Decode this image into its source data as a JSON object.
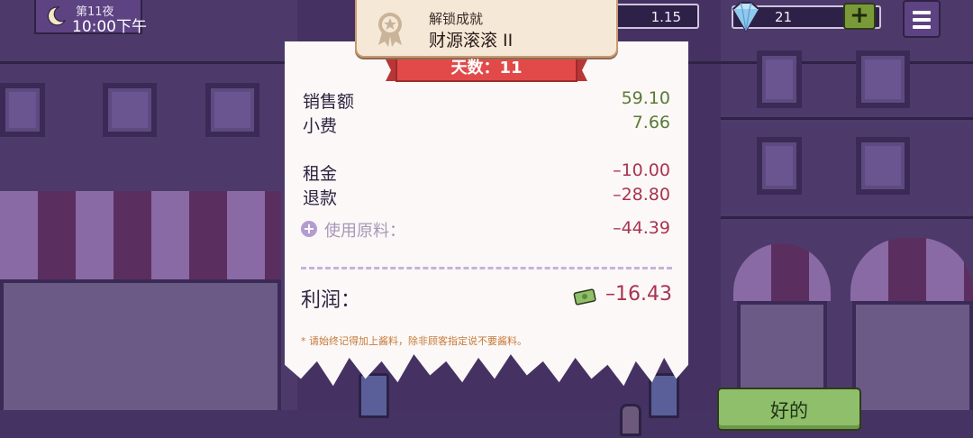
{
  "hud": {
    "night_label": "第11夜",
    "time": "10:00下午",
    "money": "1.15",
    "gems": "21",
    "plus_label": "+",
    "icons": [
      "moon-icon",
      "gem-icon",
      "menu-icon"
    ]
  },
  "achievement": {
    "title": "解锁成就",
    "name": "财源滚滚 II",
    "icon": "medal-icon"
  },
  "receipt": {
    "day_banner": "天数：11",
    "rows": [
      {
        "label": "销售额",
        "value": "59.10"
      },
      {
        "label": "小费",
        "value": "7.66"
      },
      {
        "label": "租金",
        "value": "–10.00"
      },
      {
        "label": "退款",
        "value": "–28.80"
      }
    ],
    "ingredients_label": "使用原料：",
    "ingredients_value": "–44.39",
    "profit_label": "利润：",
    "profit_value": "–16.43",
    "note": "* 请始终记得加上酱料，除非顾客指定说不要酱料。"
  },
  "ok_button": "好的",
  "colors": {
    "positive": "#5b7a36",
    "negative": "#a83450",
    "ribbon": "#e24a4a",
    "ok_button": "#8fbf6a",
    "background": "#3c2b55"
  }
}
